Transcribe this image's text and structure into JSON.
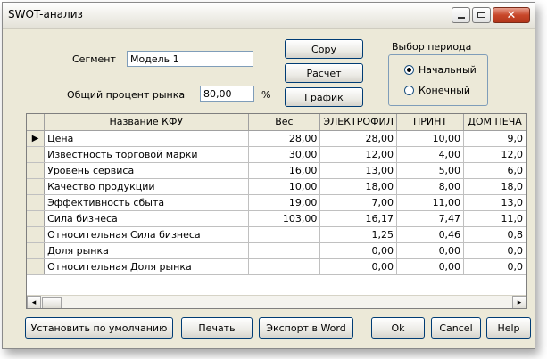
{
  "window": {
    "title": "SWOT-анализ"
  },
  "segment": {
    "label": "Сегмент",
    "value": "Модель 1"
  },
  "market_share": {
    "label": "Общий процент рынка",
    "value": "80,00",
    "unit": "%"
  },
  "actions": {
    "copy": "Copy",
    "calc": "Расчет",
    "chart": "График"
  },
  "period": {
    "title": "Выбор периода",
    "option_start": "Начальный",
    "option_end": "Конечный",
    "selected": "Начальный"
  },
  "grid": {
    "columns": [
      "Название КФУ",
      "Вес",
      "ЭЛЕКТРОФИЛ",
      "ПРИНТ",
      "ДОМ ПЕЧА"
    ],
    "current_row_marker": "▶",
    "rows": [
      [
        "Цена",
        "28,00",
        "28,00",
        "10,00",
        "9,0"
      ],
      [
        "Известность торговой марки",
        "30,00",
        "12,00",
        "4,00",
        "12,0"
      ],
      [
        "Уровень сервиса",
        "16,00",
        "13,00",
        "5,00",
        "6,0"
      ],
      [
        "Качество продукции",
        "10,00",
        "18,00",
        "8,00",
        "18,0"
      ],
      [
        "Эффективность сбыта",
        "19,00",
        "7,00",
        "11,00",
        "13,0"
      ],
      [
        "Сила бизнеса",
        "103,00",
        "16,17",
        "7,47",
        "11,0"
      ],
      [
        "Относительная Сила бизнеса",
        "",
        "1,25",
        "0,46",
        "0,8"
      ],
      [
        "Доля рынка",
        "",
        "0,00",
        "0,00",
        "0,0"
      ],
      [
        "Относительная Доля рынка",
        "",
        "0,00",
        "0,00",
        "0,0"
      ]
    ]
  },
  "footer": {
    "defaults": "Установить по умолчанию",
    "print": "Печать",
    "export": "Экспорт в Word",
    "ok": "Ok",
    "cancel": "Cancel",
    "help": "Help"
  }
}
